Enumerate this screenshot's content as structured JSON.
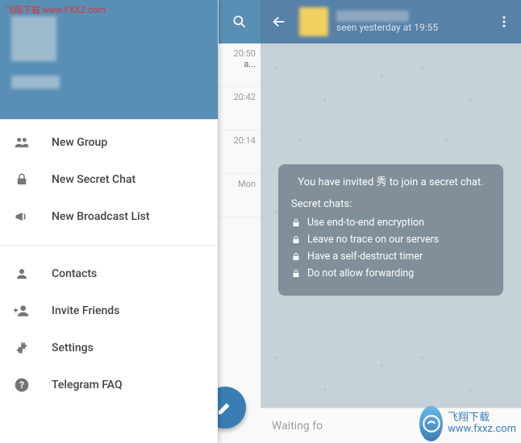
{
  "watermark": {
    "top_left_text": "飞翔下载 www.FXXZ.com",
    "bottom_right_name": "飞翔下载",
    "bottom_right_url": "www.fxxz.com"
  },
  "drawer": {
    "items": [
      {
        "icon": "group-icon",
        "label": "New Group"
      },
      {
        "icon": "lock-icon",
        "label": "New Secret Chat"
      },
      {
        "icon": "megaphone-icon",
        "label": "New Broadcast List"
      }
    ],
    "items2": [
      {
        "icon": "person-icon",
        "label": "Contacts"
      },
      {
        "icon": "person-add-icon",
        "label": "Invite Friends"
      },
      {
        "icon": "gear-icon",
        "label": "Settings"
      },
      {
        "icon": "help-icon",
        "label": "Telegram FAQ"
      }
    ]
  },
  "chatlist": {
    "rows": [
      {
        "time": "20:50",
        "preview": "a..."
      },
      {
        "time": "20:42",
        "preview": ""
      },
      {
        "time": "20:14",
        "preview": ""
      },
      {
        "time": "Mon",
        "preview": ""
      }
    ]
  },
  "secret": {
    "status": "seen yesterday at 19:55",
    "invite_line": "You have invited 秀 to join a secret chat.",
    "heading": "Secret chats:",
    "bullets": [
      "Use end-to-end encryption",
      "Leave no trace on our servers",
      "Have a self-destruct timer",
      "Do not allow forwarding"
    ],
    "input_placeholder": "Waiting fo"
  }
}
